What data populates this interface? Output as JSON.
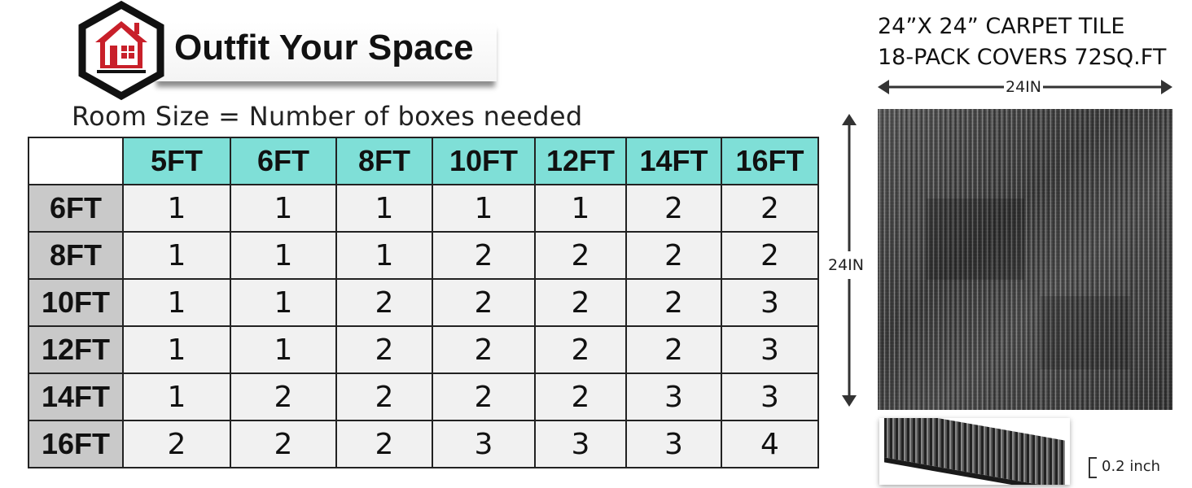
{
  "brand": {
    "name": "Outfit Your Space"
  },
  "subtitle": "Room Size = Number of boxes needed",
  "table": {
    "columns": [
      "5FT",
      "6FT",
      "8FT",
      "10FT",
      "12FT",
      "14FT",
      "16FT"
    ],
    "rows": [
      {
        "label": "6FT",
        "values": [
          "1",
          "1",
          "1",
          "1",
          "1",
          "2",
          "2"
        ]
      },
      {
        "label": "8FT",
        "values": [
          "1",
          "1",
          "1",
          "2",
          "2",
          "2",
          "2"
        ]
      },
      {
        "label": "10FT",
        "values": [
          "1",
          "1",
          "2",
          "2",
          "2",
          "2",
          "3"
        ]
      },
      {
        "label": "12FT",
        "values": [
          "1",
          "1",
          "2",
          "2",
          "2",
          "2",
          "3"
        ]
      },
      {
        "label": "14FT",
        "values": [
          "1",
          "2",
          "2",
          "2",
          "2",
          "3",
          "3"
        ]
      },
      {
        "label": "16FT",
        "values": [
          "2",
          "2",
          "2",
          "3",
          "3",
          "3",
          "4"
        ]
      }
    ]
  },
  "product": {
    "spec_line1": "24”X 24” CARPET TILE",
    "spec_line2": "18-PACK COVERS 72SQ.FT",
    "width_label": "24IN",
    "height_label": "24IN",
    "thickness_label": "0.2 inch"
  },
  "colors": {
    "header_teal": "#7fdfd7",
    "row_header_gray": "#c9c9c9",
    "cell_bg": "#f1f1f1",
    "logo_red": "#c8202a"
  },
  "icons": {
    "logo": "house-hexagon-icon"
  }
}
